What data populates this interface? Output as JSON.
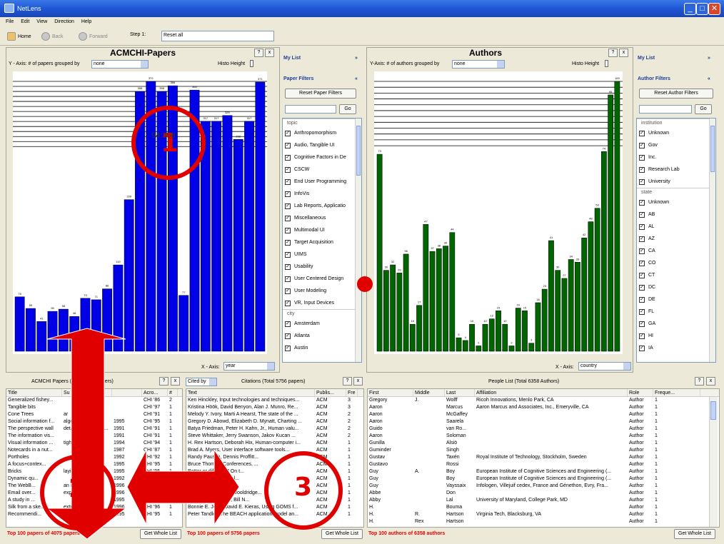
{
  "window": {
    "title": "NetLens",
    "min": "_",
    "max": "□",
    "close": "✕"
  },
  "menu": [
    "File",
    "Edit",
    "View",
    "Direction",
    "Help"
  ],
  "nav": {
    "home": "Home",
    "back": "Back",
    "forward": "Forward",
    "step_label": "Step 1:",
    "step_value": "Reset all"
  },
  "papers": {
    "title": "ACMCHI-Papers",
    "y_axis_label": "Y - Axis: # of papers grouped by",
    "y_group": "none",
    "histo": "Histo Height",
    "x_axis_label": "X - Axis:",
    "x_value": "year",
    "hover_label": "94:358",
    "chart_data": {
      "type": "bar",
      "color": "#0000e6",
      "values": [
        75,
        59,
        41,
        55,
        58,
        48,
        73,
        71,
        86,
        119,
        209,
        358,
        372,
        358,
        366,
        77,
        360,
        317,
        317,
        325,
        292,
        317,
        371
      ]
    }
  },
  "authors": {
    "title": "Authors",
    "y_axis_label": "Y-Axis: # of authors grouped by",
    "y_group": "none",
    "histo": "Histo Height",
    "x_axis_label": "X - Axis:",
    "x_value": "country",
    "chart_data": {
      "type": "bar",
      "color": "#006400",
      "values": [
        73,
        30,
        32,
        29,
        36,
        10,
        17,
        47,
        37,
        38,
        39,
        44,
        5,
        4,
        10,
        2,
        10,
        12,
        15,
        10,
        2,
        16,
        15,
        3,
        18,
        23,
        41,
        30,
        27,
        34,
        33,
        42,
        48,
        53,
        74,
        95,
        100
      ]
    }
  },
  "paper_filters": {
    "mylist": "My List",
    "title": "Paper Filters",
    "reset": "Reset Paper Filters",
    "go": "Go",
    "group_topic": "topic",
    "topics": [
      "Anthropomorphism",
      "Audio, Tangible UI",
      "Cognitive Factors in De",
      "CSCW",
      "End User Programming",
      "InfoVis",
      "Lab Reports, Applicatio",
      "Miscellaneous",
      "Multimodal UI",
      "Target Acquisition",
      "UIMS",
      "Usability",
      "User Centered Design",
      "User Modeling",
      "VR, Input Devices"
    ],
    "group_city": "city",
    "cities": [
      "Amsterdam",
      "Atlanta",
      "Austin"
    ]
  },
  "author_filters": {
    "mylist": "My List",
    "title": "Author Filters",
    "reset": "Reset Author Filters",
    "go": "Go",
    "group_institution": "institution",
    "institutions": [
      "Unknown",
      "Gov",
      "Inc.",
      "Research Lab",
      "University"
    ],
    "group_state": "state",
    "states": [
      "Unknown",
      "AB",
      "AL",
      "AZ",
      "CA",
      "CO",
      "CT",
      "DC",
      "DE",
      "FL",
      "GA",
      "HI",
      "IA"
    ]
  },
  "papers_table": {
    "title": "ACMCHI Papers (Total 4075 Papers)",
    "columns": [
      "Title",
      "Su",
      "",
      "Acro...",
      "#"
    ],
    "rows": [
      [
        "Generalized fishey...",
        "",
        "",
        "CHI '86",
        "2"
      ],
      [
        "Tangible bits",
        "",
        "",
        "CHI '97",
        "1"
      ],
      [
        "Cone Trees",
        "ar",
        "",
        "CHI '91",
        "1"
      ],
      [
        "Social information f...",
        "algorithms ...",
        "1995",
        "CHI '95",
        "1"
      ],
      [
        "The perspective wall",
        "detail and context ...",
        "1991",
        "CHI '91",
        "1"
      ],
      [
        "The information vis...",
        "",
        "1991",
        "CHI '91",
        "1"
      ],
      [
        "Visual information ...",
        "tight coupling of ...",
        "1994",
        "CHI '94",
        "1"
      ],
      [
        "Notecards in a nut...",
        "",
        "1987",
        "CHI '87",
        "1"
      ],
      [
        "Portholes",
        "",
        "1992",
        "CHI '92",
        "1"
      ],
      [
        "A focus+contex...",
        "",
        "1995",
        "CHI '95",
        "1"
      ],
      [
        "Bricks",
        "laying the found...",
        "1995",
        "CHI '95",
        "1"
      ],
      [
        "Dynamic qu...",
        "",
        "1992",
        "CHI '92",
        "1"
      ],
      [
        "The WebB...",
        "an information w...",
        "1996",
        "CHI '96",
        "1"
      ],
      [
        "Email over...",
        "exploring person...",
        "1996",
        "CHI '96",
        "1"
      ],
      [
        "A study in ...",
        "",
        "1995",
        "CHI '95",
        "1"
      ],
      [
        "Silk from a ske...",
        "extracting usab...",
        "1996",
        "CHI '96",
        "1"
      ],
      [
        "Recommendi...",
        "",
        "1995",
        "CHI '95",
        "1"
      ]
    ],
    "footer": "Top 100 papers of 4075 papers",
    "get_all": "Get Whole List"
  },
  "citations_table": {
    "cited_by": "Cited by",
    "title": "Citations (Total 5756 papers)",
    "columns": [
      "Text",
      "Publis...",
      "Fre"
    ],
    "rows": [
      [
        "Ken Hinckley, Input technologies and techniques...",
        "ACM",
        "3"
      ],
      [
        "Kristina Höök, David Benyon, Alan J. Munro, Re...",
        "ACM",
        "3"
      ],
      [
        "Melody Y. Ivory, Marti A Hearst, The state of the ...",
        "ACM",
        "2"
      ],
      [
        "Gregory D. Abowd, Elizabeth D. Mynatt, Charting ...",
        "ACM",
        "2"
      ],
      [
        "Batya Friedman, Peter H. Kahn, Jr., Human valu...",
        "ACM",
        "2"
      ],
      [
        "Steve Whittaker, Jerry Swanson, Jakov Kucan ...",
        "ACM",
        "2"
      ],
      [
        "H. Rex Hartson, Deborah Hix, Human-computer i...",
        "ACM",
        "1"
      ],
      [
        "Brad A. Myers, User interface software tools...",
        "ACM",
        "1"
      ],
      [
        "Randy Pausch, Dennis Proffitt...",
        "ACM",
        "1"
      ],
      [
        "Bruce Thomas, Conferences, ...",
        "ACM",
        "1"
      ],
      [
        "Better or different? On t...",
        "ACM",
        "1"
      ],
      [
        "Terveen, Will Hill, Del...",
        "ACM",
        "1"
      ],
      [
        "SATIN: a tool...",
        "ACM",
        "1"
      ],
      [
        "Jason Landay, Alan Wooldridge...",
        "ACM",
        "1"
      ],
      [
        "Gene Golovchinsky, Bill N...",
        "ACM",
        "1"
      ],
      [
        "Bonnie E. John, David E. Kieras, Using GOMS f...",
        "ACM",
        "1"
      ],
      [
        "Peter Tandler, The BEACH application model an...",
        "ACM",
        "1"
      ]
    ],
    "footer": "Top 100 papers of 5756 papers",
    "get_all": "Get Whole List"
  },
  "people_table": {
    "title": "People List (Total 6358 Authors)",
    "columns": [
      "First",
      "Middle",
      "Last",
      "Affiliation",
      "Role",
      "Freque..."
    ],
    "rows": [
      [
        "Gregory",
        "J.",
        "Wolff",
        "Ricoh Innovations, Menlo Park, CA",
        "Author",
        "1"
      ],
      [
        "Aaron",
        "",
        "Marcus",
        "Aaron Marcus and Associates, Inc., Emeryville, CA",
        "Author",
        "1"
      ],
      [
        "Aaron",
        "",
        "McGaffey",
        "",
        "Author",
        "1"
      ],
      [
        "Aaron",
        "",
        "Saarela",
        "",
        "Author",
        "1"
      ],
      [
        "Guido",
        "",
        "van Ro...",
        "",
        "Author",
        "1"
      ],
      [
        "Aaron",
        "",
        "Soloman",
        "",
        "Author",
        "1"
      ],
      [
        "Gunilla",
        "",
        "Alsiö",
        "",
        "Author",
        "1"
      ],
      [
        "Guminder",
        "",
        "Singh",
        "",
        "Author",
        "1"
      ],
      [
        "Gustav",
        "",
        "Taxén",
        "Royal Institute of Technology, Stockholm, Sweden",
        "Author",
        "1"
      ],
      [
        "Gustavo",
        "",
        "Rossi",
        "",
        "Author",
        "1"
      ],
      [
        "Guy",
        "A.",
        "Boy",
        "European Institute of Cognitive Sciences and Engineering (...",
        "Author",
        "1"
      ],
      [
        "Guy",
        "",
        "Boy",
        "European Institute of Cognitive Sciences and Engineering (...",
        "Author",
        "1"
      ],
      [
        "Guy",
        "",
        "Vayssaix",
        "Infologen, Villejuif cedex, France and Génethon, Evry, Fra...",
        "Author",
        "1"
      ],
      [
        "Abbe",
        "",
        "Don",
        "",
        "Author",
        "1"
      ],
      [
        "Abby",
        "",
        "Lal",
        "University of Maryland, College Park, MD",
        "Author",
        "1"
      ],
      [
        "H.",
        "",
        "Bouma",
        "",
        "Author",
        "1"
      ],
      [
        "H.",
        "R.",
        "Hartson",
        "Virginia Tech, Blacksburg, VA",
        "Author",
        "1"
      ],
      [
        "H.",
        "Rex",
        "Hartson",
        "",
        "Author",
        "1"
      ]
    ],
    "footer": "Top 100 authors of 6358 authors",
    "get_all": "Get Whole List"
  },
  "annotations": {
    "one": "1",
    "two": "2",
    "three": "3",
    "color": "#e00000"
  }
}
